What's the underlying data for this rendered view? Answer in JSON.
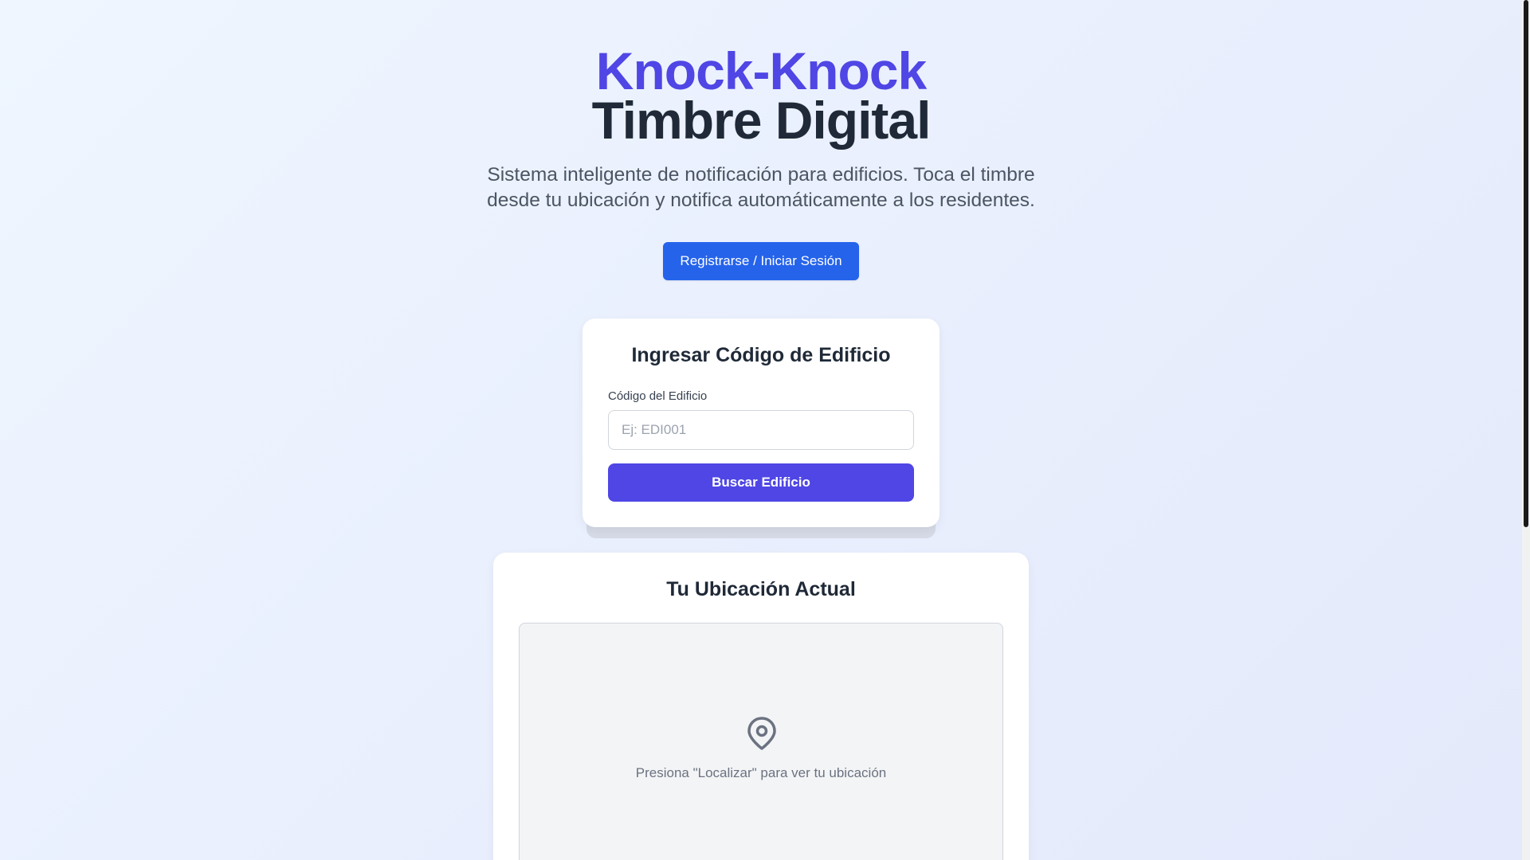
{
  "hero": {
    "title_line1": "Knock-Knock",
    "title_line2": "Timbre Digital",
    "subtitle": "Sistema inteligente de notificación para edificios. Toca el timbre desde tu ubicación y notifica automáticamente a los residentes.",
    "cta_label": "Registrarse / Iniciar Sesión"
  },
  "building_code": {
    "title": "Ingresar Código de Edificio",
    "field_label": "Código del Edificio",
    "input_value": "",
    "input_placeholder": "Ej: EDI001",
    "search_label": "Buscar Edificio"
  },
  "location": {
    "title": "Tu Ubicación Actual",
    "hint": "Presiona \"Localizar\" para ver tu ubicación",
    "icon": "map-pin-icon"
  },
  "colors": {
    "brand": "#4f46e5",
    "cta": "#2563eb",
    "text_dark": "#1f2937",
    "text_muted": "#6b7280"
  }
}
